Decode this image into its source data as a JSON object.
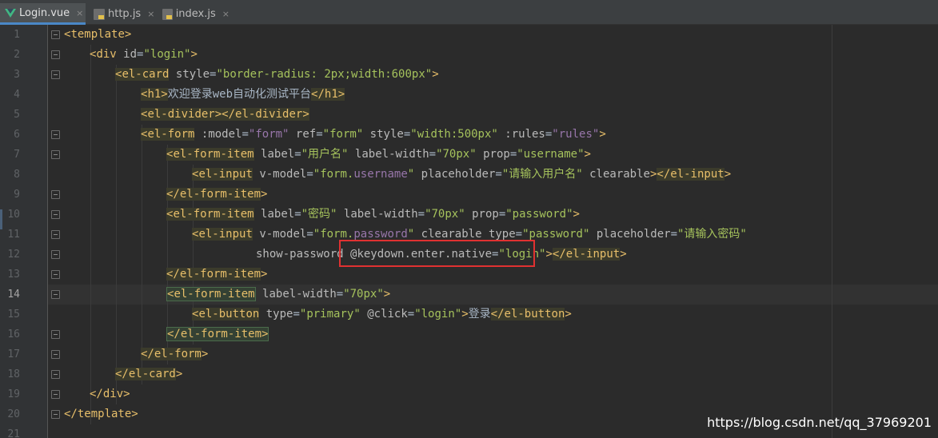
{
  "tabs": [
    {
      "label": "Login.vue",
      "icon": "vue-file-icon",
      "active": true
    },
    {
      "label": "http.js",
      "icon": "js-file-icon"
    },
    {
      "label": "index.js",
      "icon": "js-file-icon"
    }
  ],
  "close_glyph": "×",
  "line_numbers": [
    "1",
    "2",
    "3",
    "4",
    "5",
    "6",
    "7",
    "8",
    "9",
    "10",
    "11",
    "12",
    "13",
    "14",
    "15",
    "16",
    "17",
    "18",
    "19",
    "20",
    "21"
  ],
  "code": {
    "l1": {
      "tag": "template"
    },
    "l2": {
      "tag": "div",
      "attr": "id",
      "val": "\"login\""
    },
    "l3": {
      "tag": "el-card",
      "attr": "style",
      "val": "\"border-radius: 2px;width:600px\""
    },
    "l4": {
      "tag": "h1",
      "text": "欢迎登录web自动化测试平台",
      "close": "h1"
    },
    "l5": {
      "tag": "el-divider",
      "close": "el-divider"
    },
    "l6": {
      "tag": "el-form",
      "a1": ":model",
      "v1": "\"form\"",
      "a2": "ref",
      "v2": "\"form\"",
      "a3": "style",
      "v3": "\"width:500px\"",
      "a4": ":rules",
      "v4": "\"rules\""
    },
    "l7": {
      "tag": "el-form-item",
      "a1": "label",
      "v1": "\"用户名\"",
      "a2": "label-width",
      "v2": "\"70px\"",
      "a3": "prop",
      "v3": "\"username\""
    },
    "l8": {
      "tag": "el-input",
      "a1": "v-model",
      "v1a": "\"form.",
      "v1b": "username",
      "v1c": "\"",
      "a2": "placeholder",
      "v2": "\"请输入用户名\"",
      "a3": "clearable",
      "close": "el-input"
    },
    "l9": {
      "close": "el-form-item"
    },
    "l10": {
      "tag": "el-form-item",
      "a1": "label",
      "v1": "\"密码\"",
      "a2": "label-width",
      "v2": "\"70px\"",
      "a3": "prop",
      "v3": "\"password\""
    },
    "l11": {
      "tag": "el-input",
      "a1": "v-model",
      "v1a": "\"form.",
      "v1b": "password",
      "v1c": "\"",
      "a2": "clearable",
      "a3": "type",
      "v3": "\"password\"",
      "a4": "placeholder",
      "v4": "\"请输入密码\""
    },
    "l12": {
      "a1": "show-password",
      "a2": "@keydown.enter.native",
      "v2": "\"login\"",
      "close": "el-input"
    },
    "l13": {
      "close": "el-form-item"
    },
    "l14": {
      "tag": "el-form-item",
      "a1": "label-width",
      "v1": "\"70px\""
    },
    "l15": {
      "tag": "el-button",
      "a1": "type",
      "v1": "\"primary\"",
      "a2": "@click",
      "v2": "\"login\"",
      "text": "登录",
      "close": "el-button"
    },
    "l16": {
      "close": "el-form-item"
    },
    "l17": {
      "close": "el-form"
    },
    "l18": {
      "close": "el-card"
    },
    "l19": {
      "close": "div"
    },
    "l20": {
      "close": "template"
    }
  },
  "watermark": "https://blog.csdn.net/qq_37969201",
  "colors": {
    "tag": "#e8bf6a",
    "attr_value": "#a5c25c",
    "vue_property": "#9876aa",
    "highlight_box": "#e03131",
    "active_tab_underline": "#4a88c7"
  }
}
